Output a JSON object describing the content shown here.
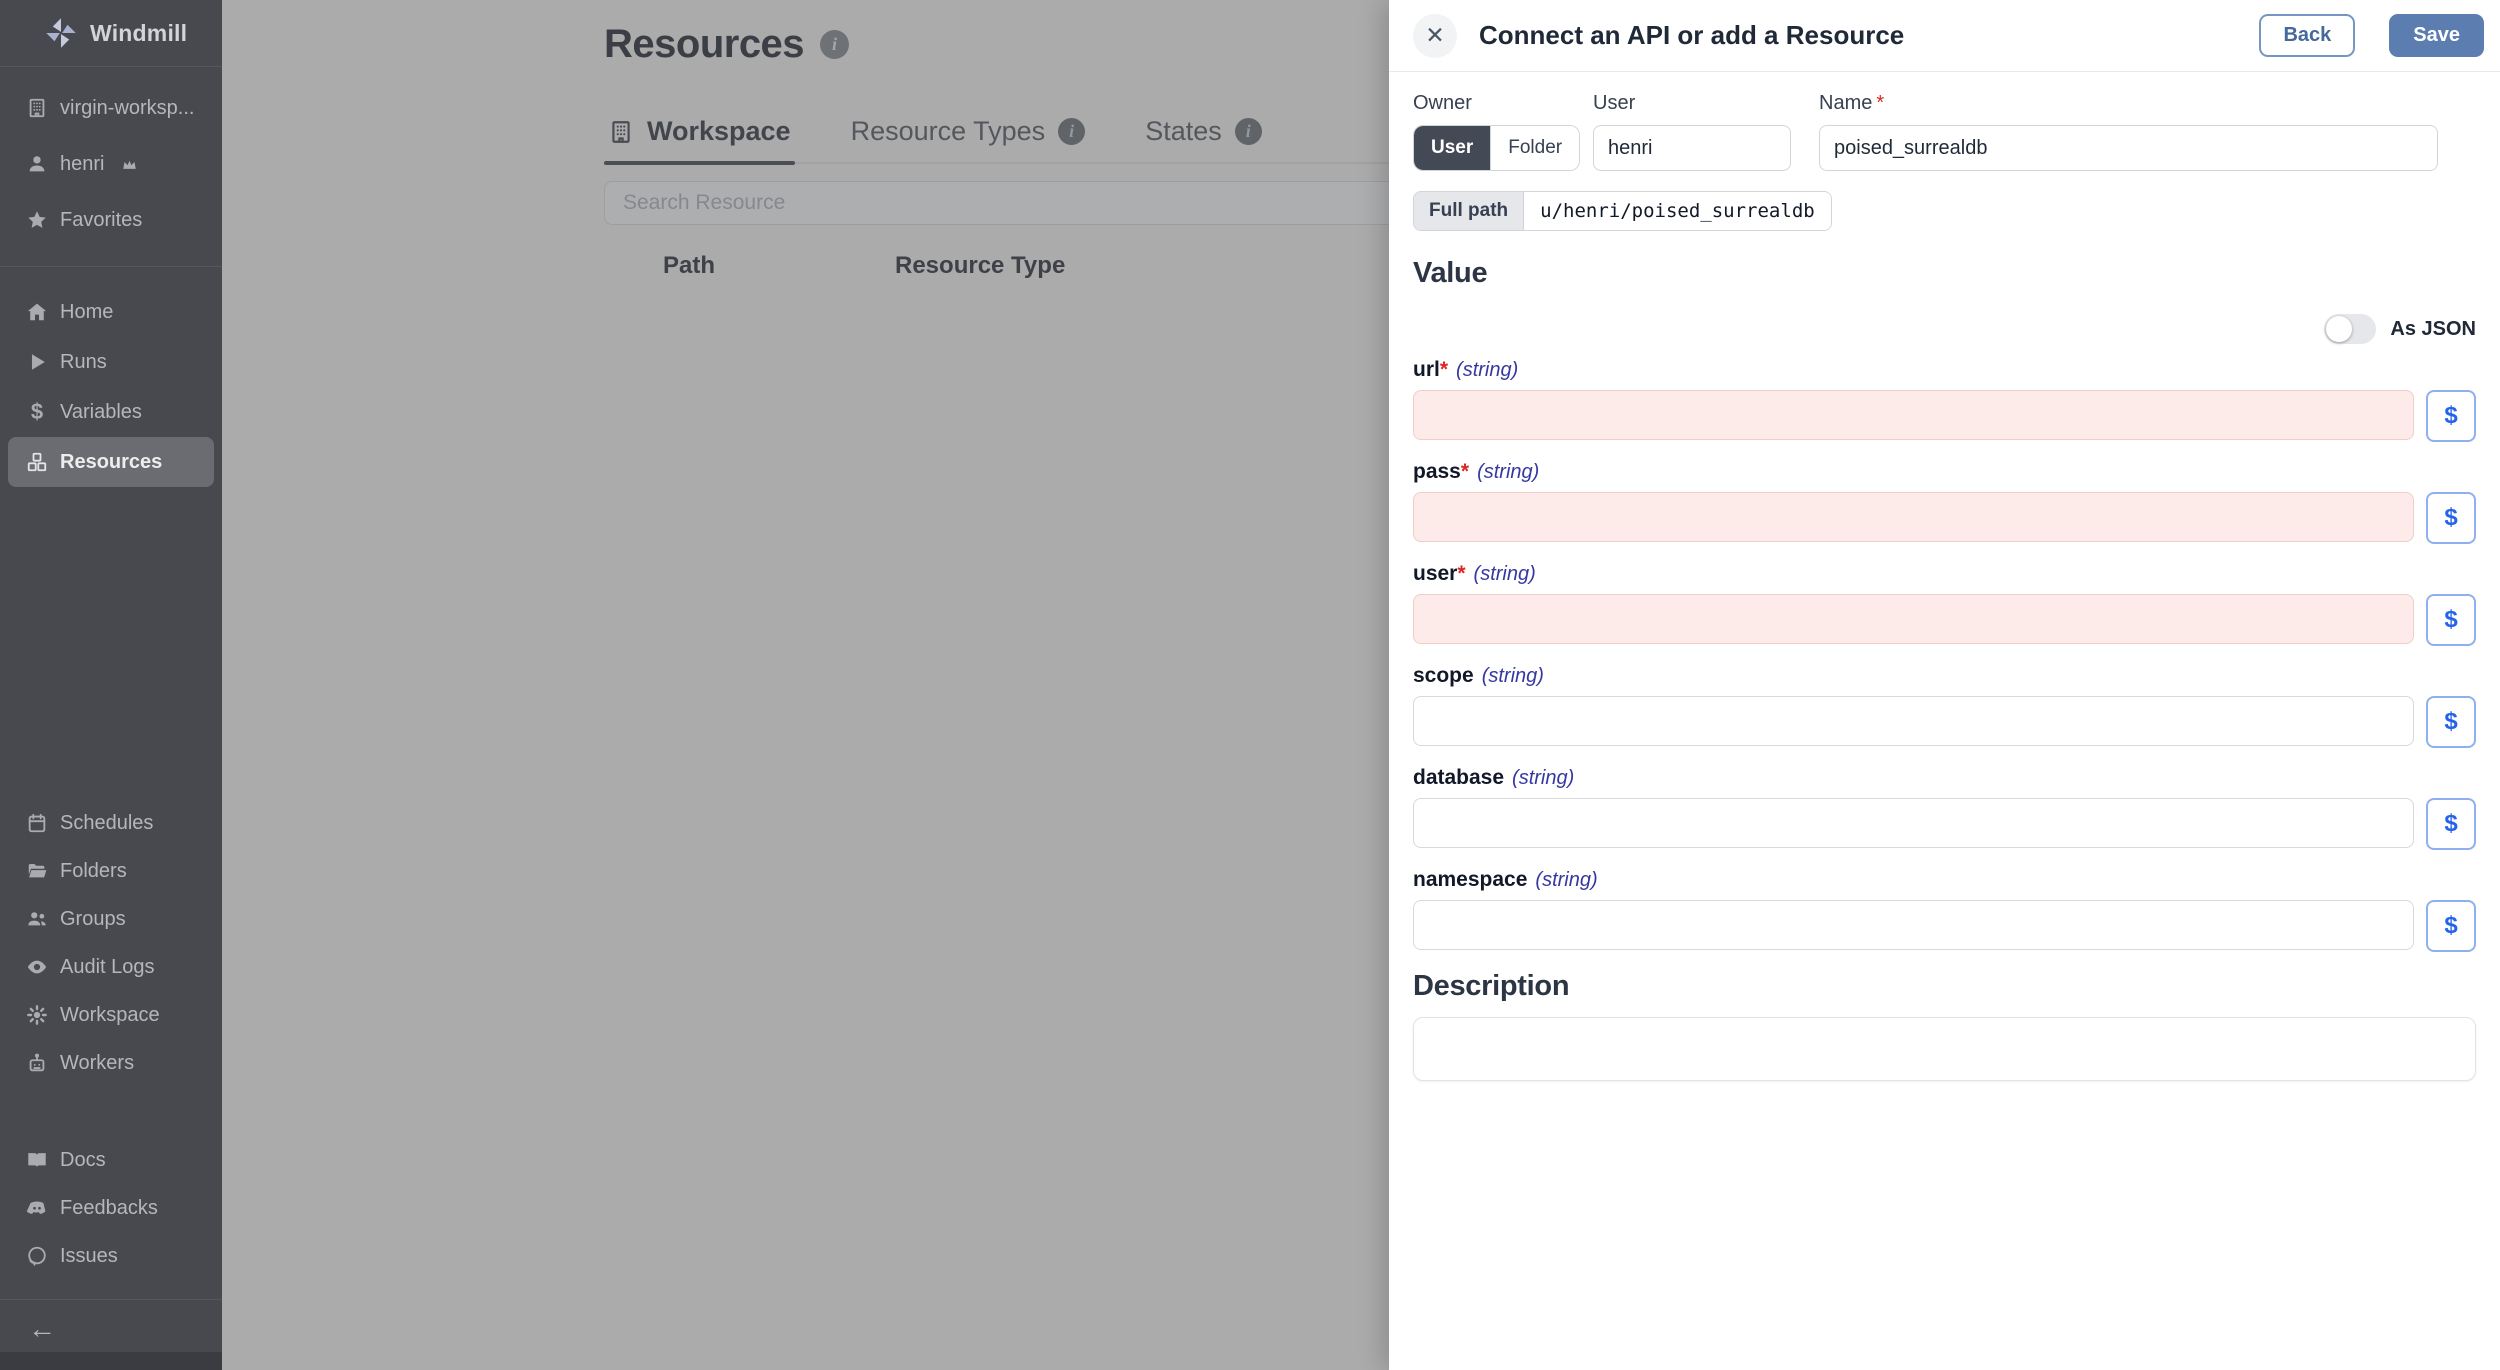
{
  "app": {
    "logo_label": "Windmill"
  },
  "sidebar": {
    "workspace_group": [
      {
        "label": "virgin-worksp..."
      },
      {
        "label": "henri"
      },
      {
        "label": "Favorites"
      }
    ],
    "nav": [
      {
        "label": "Home"
      },
      {
        "label": "Runs"
      },
      {
        "label": "Variables"
      },
      {
        "label": "Resources"
      }
    ],
    "admin_nav": [
      {
        "label": "Schedules"
      },
      {
        "label": "Folders"
      },
      {
        "label": "Groups"
      },
      {
        "label": "Audit Logs"
      },
      {
        "label": "Workspace"
      },
      {
        "label": "Workers"
      }
    ],
    "links": [
      {
        "label": "Docs"
      },
      {
        "label": "Feedbacks"
      },
      {
        "label": "Issues"
      }
    ]
  },
  "main": {
    "title": "Resources",
    "tabs": [
      {
        "label": "Workspace"
      },
      {
        "label": "Resource Types"
      },
      {
        "label": "States"
      }
    ],
    "search_placeholder": "Search Resource",
    "columns": [
      {
        "label": "Path"
      },
      {
        "label": "Resource Type"
      }
    ]
  },
  "drawer": {
    "title": "Connect an API or add a Resource",
    "back_label": "Back",
    "save_label": "Save",
    "owner_label": "Owner",
    "owner_options": [
      {
        "label": "User"
      },
      {
        "label": "Folder"
      }
    ],
    "owner_selected": "User",
    "user_label": "User",
    "user_value": "henri",
    "name_label": "Name",
    "required_mark": "*",
    "name_value": "poised_surrealdb",
    "full_path_label": "Full path",
    "full_path_value": "u/henri/poised_surrealdb",
    "value_heading": "Value",
    "as_json_label": "As JSON",
    "as_json_on": false,
    "dollar_label": "$",
    "fields": [
      {
        "name": "url",
        "type": "(string)",
        "required": true
      },
      {
        "name": "pass",
        "type": "(string)",
        "required": true
      },
      {
        "name": "user",
        "type": "(string)",
        "required": true
      },
      {
        "name": "scope",
        "type": "(string)",
        "required": false
      },
      {
        "name": "database",
        "type": "(string)",
        "required": false
      },
      {
        "name": "namespace",
        "type": "(string)",
        "required": false
      }
    ],
    "description_heading": "Description",
    "description_value": ""
  },
  "colors": {
    "accent": "#5b7db0",
    "required_field_bg": "#fcebe8",
    "type_annotation": "#3538a0",
    "asterisk_red": "#dc2626",
    "sidebar_bg": "#47494f",
    "dimmed_bg": "#ababab"
  }
}
